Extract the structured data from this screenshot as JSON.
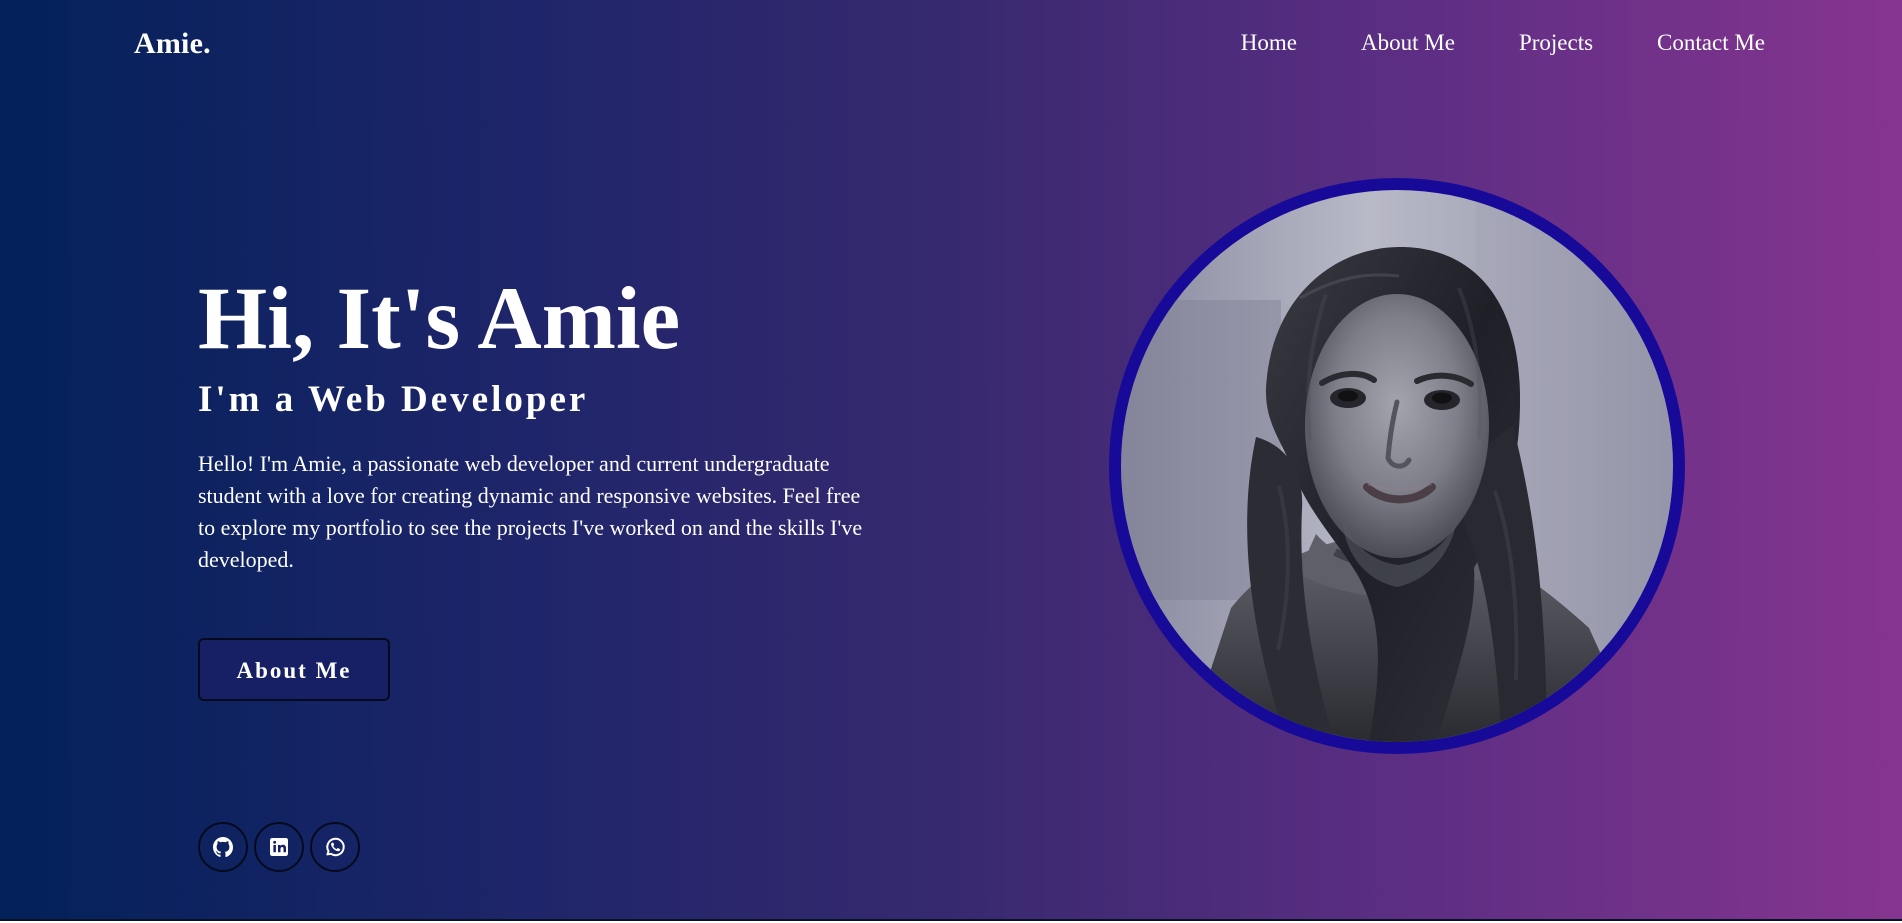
{
  "header": {
    "logo": "Amie.",
    "nav": [
      "Home",
      "About Me",
      "Projects",
      "Contact Me"
    ]
  },
  "hero": {
    "title": "Hi, It's Amie",
    "subtitle": "I'm a Web Developer",
    "description": "Hello! I'm Amie, a passionate web developer and current undergraduate student with a love for creating dynamic and responsive websites. Feel free to explore my portfolio to see the projects I've worked on and the skills I've developed.",
    "button_label": "About Me"
  },
  "socials": [
    {
      "icon": "github-icon"
    },
    {
      "icon": "linkedin-icon"
    },
    {
      "icon": "whatsapp-icon"
    }
  ],
  "profile": {
    "image_style": "grayscale portrait",
    "ring_color": "#180a98"
  },
  "colors": {
    "gradient_start": "#03215a",
    "gradient_end": "#86358f",
    "button_bg": "#172064",
    "text": "#ffffff"
  }
}
